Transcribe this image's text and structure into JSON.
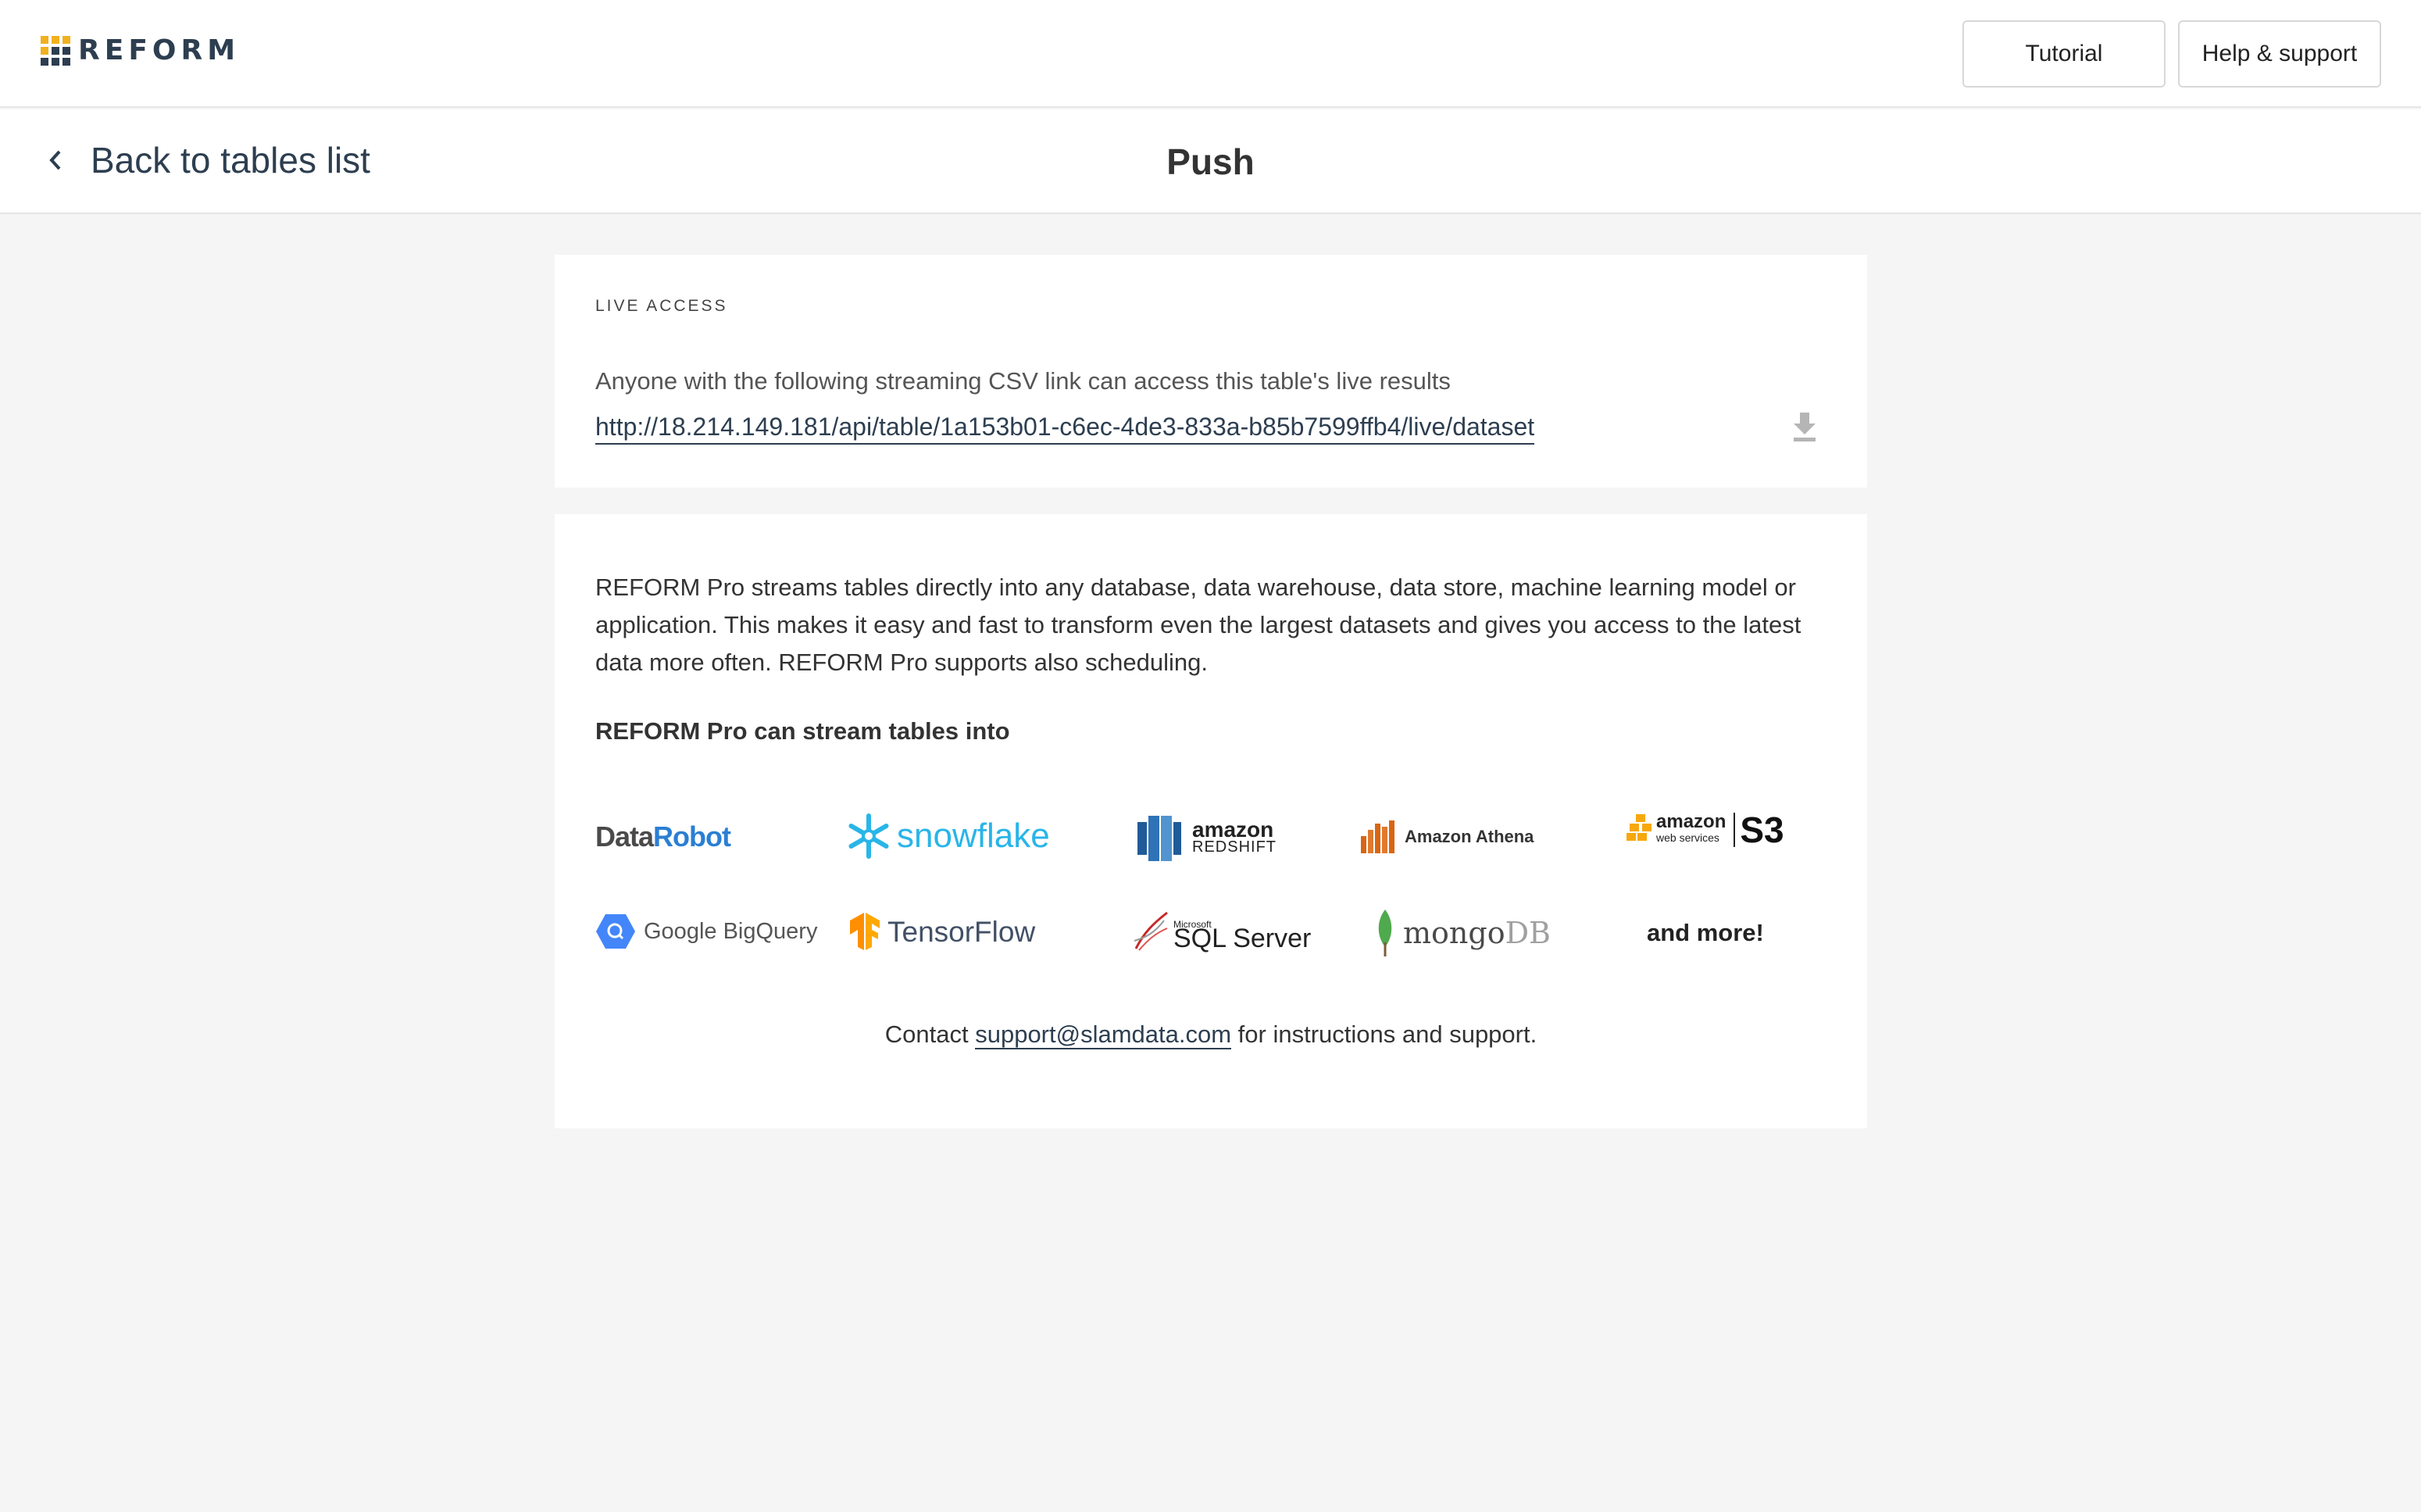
{
  "header": {
    "logo_text": "REFORM",
    "tutorial_label": "Tutorial",
    "help_label": "Help & support"
  },
  "subheader": {
    "back_label": "Back to tables list",
    "title": "Push"
  },
  "live_access": {
    "section_label": "LIVE ACCESS",
    "description": "Anyone with the following streaming CSV link can access this table's live results",
    "link": "http://18.214.149.181/api/table/1a153b01-c6ec-4de3-833a-b85b7599ffb4/live/dataset"
  },
  "pro": {
    "description": "REFORM Pro streams tables directly into any database, data warehouse, data store, machine learning model or application. This makes it easy and fast to transform even the largest datasets and gives you access to the latest data more often. REFORM Pro supports also scheduling.",
    "subheading": "REFORM Pro can stream tables into",
    "integrations": {
      "datarobot_a": "Data",
      "datarobot_b": "Robot",
      "snowflake": "snowflake",
      "redshift_a": "amazon",
      "redshift_b": "REDSHIFT",
      "athena": "Amazon Athena",
      "s3_a": "amazon",
      "s3_b": "web services",
      "s3_c": "S3",
      "bigquery": "Google BigQuery",
      "tensorflow": "TensorFlow",
      "sqlserver_a": "Microsoft",
      "sqlserver_b": "SQL Server",
      "mongodb_a": "mongo",
      "mongodb_b": "DB",
      "more": "and more!"
    },
    "contact_prefix": "Contact ",
    "contact_email": "support@slamdata.com",
    "contact_suffix": " for instructions and support."
  }
}
